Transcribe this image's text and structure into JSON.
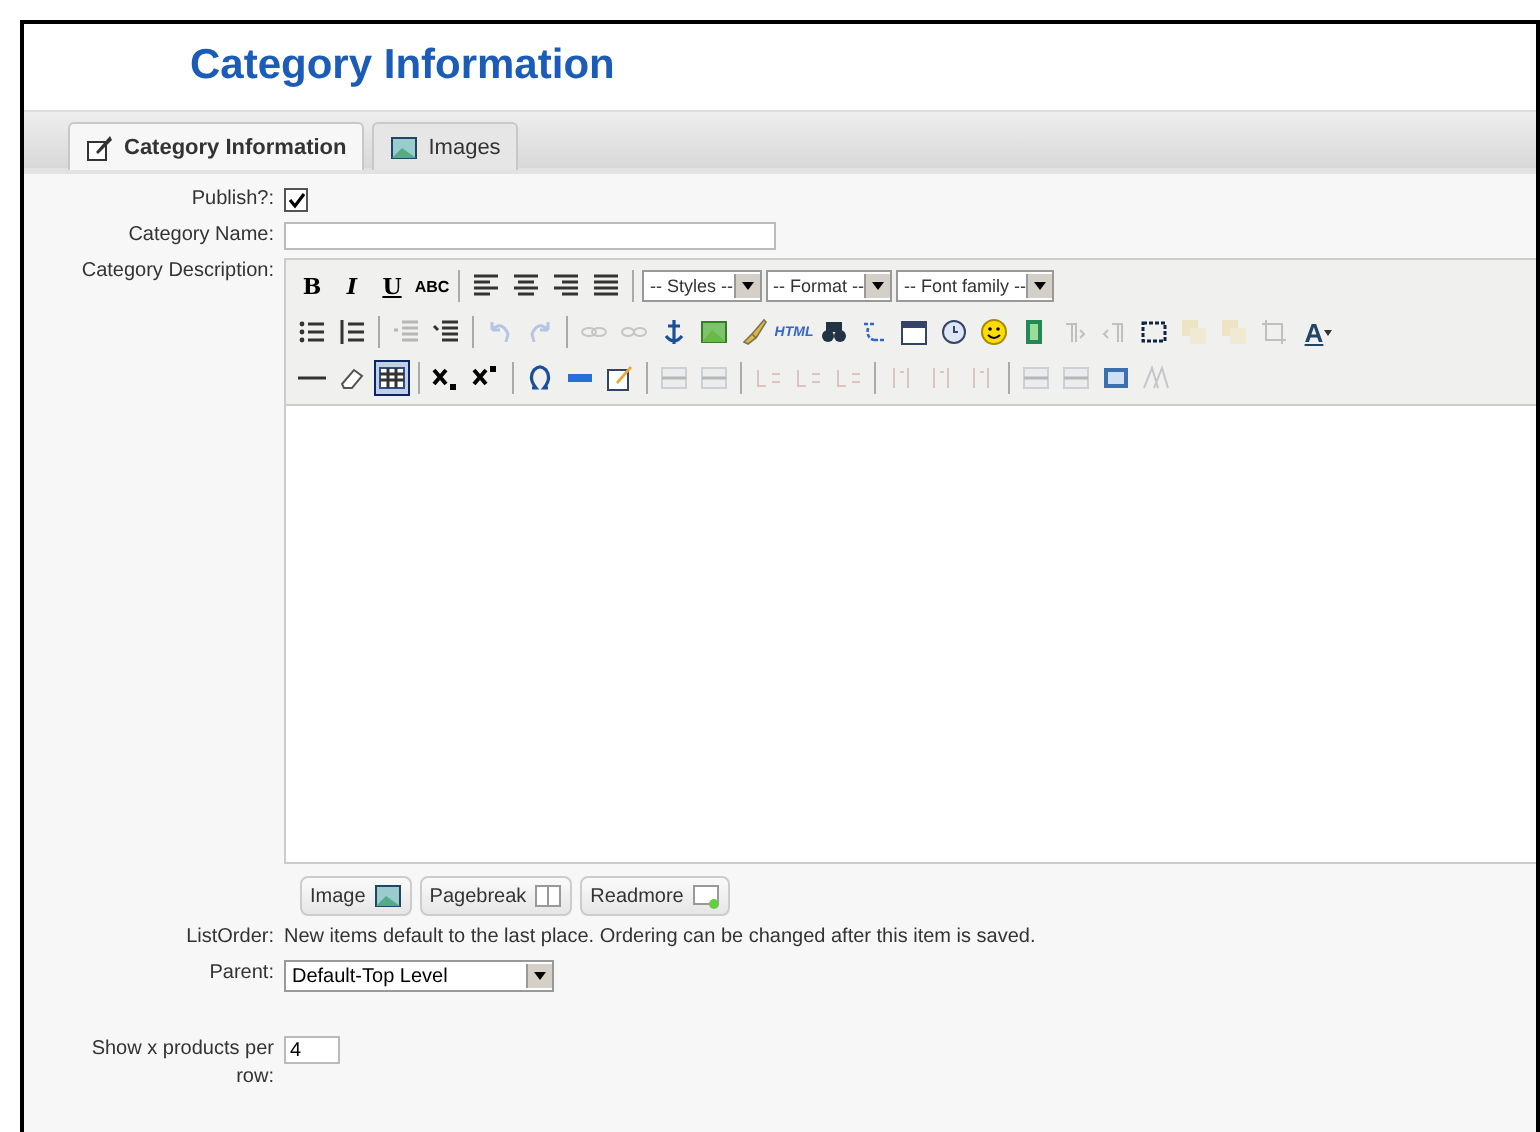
{
  "page_title": "Category Information",
  "tabs": [
    {
      "label": "Category Information",
      "selected": true,
      "kind": "edit"
    },
    {
      "label": "Images",
      "selected": false,
      "kind": "picture"
    }
  ],
  "publish": {
    "label": "Publish?:",
    "checked": true
  },
  "category_name": {
    "label": "Category Name:"
  },
  "description": {
    "label": "Category Description:",
    "toolbar_rows": [
      [
        {
          "kind": "bold",
          "label": "B",
          "disabled": false,
          "active": false
        },
        {
          "kind": "italic",
          "label": "I",
          "disabled": false,
          "active": false
        },
        {
          "kind": "underline",
          "label": "U",
          "disabled": false,
          "active": false
        },
        {
          "kind": "strike",
          "label": "ABC",
          "disabled": false,
          "active": false
        },
        {
          "kind": "sep"
        },
        {
          "kind": "alignleft",
          "disabled": false,
          "active": false
        },
        {
          "kind": "aligncenter",
          "disabled": false,
          "active": false
        },
        {
          "kind": "alignright",
          "disabled": false,
          "active": false
        },
        {
          "kind": "justify",
          "disabled": false,
          "active": false
        },
        {
          "kind": "sep"
        },
        {
          "kind": "select",
          "label": "-- Styles --"
        },
        {
          "kind": "select",
          "label": "-- Format --"
        },
        {
          "kind": "select",
          "label": "-- Font family --"
        }
      ],
      [
        {
          "kind": "bullets",
          "disabled": false,
          "active": false
        },
        {
          "kind": "numbers",
          "disabled": false,
          "active": false
        },
        {
          "kind": "sep"
        },
        {
          "kind": "outdent",
          "disabled": true,
          "active": false
        },
        {
          "kind": "indent",
          "disabled": false,
          "active": false
        },
        {
          "kind": "sep"
        },
        {
          "kind": "undo",
          "disabled": true,
          "active": false
        },
        {
          "kind": "redo",
          "disabled": true,
          "active": false
        },
        {
          "kind": "sep"
        },
        {
          "kind": "link",
          "disabled": true,
          "active": false
        },
        {
          "kind": "unlink",
          "disabled": true,
          "active": false
        },
        {
          "kind": "anchor",
          "disabled": false,
          "active": false
        },
        {
          "kind": "image",
          "disabled": false,
          "active": false
        },
        {
          "kind": "brush",
          "disabled": false,
          "active": false
        },
        {
          "kind": "html",
          "label": "HTML",
          "disabled": false,
          "active": false
        },
        {
          "kind": "find",
          "disabled": false,
          "active": false
        },
        {
          "kind": "replace",
          "disabled": false,
          "active": false
        },
        {
          "kind": "date",
          "disabled": false,
          "active": false
        },
        {
          "kind": "clock",
          "disabled": false,
          "active": false
        },
        {
          "kind": "smiley",
          "disabled": false,
          "active": false
        },
        {
          "kind": "film",
          "disabled": false,
          "active": false
        },
        {
          "kind": "ltr",
          "disabled": true,
          "active": false
        },
        {
          "kind": "rtl",
          "disabled": true,
          "active": false
        },
        {
          "kind": "fullscreen",
          "disabled": false,
          "active": false
        },
        {
          "kind": "layer",
          "disabled": true,
          "active": false
        },
        {
          "kind": "layer",
          "disabled": true,
          "active": false
        },
        {
          "kind": "absolute",
          "disabled": true,
          "active": false
        },
        {
          "kind": "textcolor",
          "label": "A",
          "disabled": false,
          "active": false
        }
      ],
      [
        {
          "kind": "rule",
          "disabled": false,
          "active": false
        },
        {
          "kind": "eraser",
          "disabled": false,
          "active": false
        },
        {
          "kind": "table",
          "disabled": false,
          "active": true
        },
        {
          "kind": "sep"
        },
        {
          "kind": "sub",
          "disabled": false,
          "active": false
        },
        {
          "kind": "sup",
          "disabled": false,
          "active": false
        },
        {
          "kind": "sep"
        },
        {
          "kind": "omega",
          "disabled": false,
          "active": false
        },
        {
          "kind": "bar",
          "disabled": false,
          "active": false
        },
        {
          "kind": "note",
          "disabled": false,
          "active": false
        },
        {
          "kind": "sep"
        },
        {
          "kind": "grid",
          "disabled": true,
          "active": false
        },
        {
          "kind": "grid",
          "disabled": true,
          "active": false
        },
        {
          "kind": "sep"
        },
        {
          "kind": "rowins",
          "disabled": true,
          "active": false
        },
        {
          "kind": "rowins",
          "disabled": true,
          "active": false
        },
        {
          "kind": "rowins",
          "disabled": true,
          "active": false
        },
        {
          "kind": "sep"
        },
        {
          "kind": "colins",
          "disabled": true,
          "active": false
        },
        {
          "kind": "colins",
          "disabled": true,
          "active": false
        },
        {
          "kind": "colins",
          "disabled": true,
          "active": false
        },
        {
          "kind": "sep"
        },
        {
          "kind": "grid",
          "disabled": true,
          "active": false
        },
        {
          "kind": "grid",
          "disabled": true,
          "active": false
        },
        {
          "kind": "window",
          "disabled": false,
          "active": false
        },
        {
          "kind": "styleprops",
          "disabled": true,
          "active": false
        }
      ]
    ],
    "buttons": [
      {
        "label": "Image",
        "kind": "picture"
      },
      {
        "label": "Pagebreak",
        "kind": "pagebreak"
      },
      {
        "label": "Readmore",
        "kind": "readmore"
      }
    ]
  },
  "list_order": {
    "label": "ListOrder:",
    "text": "New items default to the last place. Ordering can be changed after this item is saved."
  },
  "parent": {
    "label": "Parent:",
    "value": "Default-Top Level"
  },
  "products_per_row": {
    "label": "Show x products per row:",
    "value": "4"
  }
}
